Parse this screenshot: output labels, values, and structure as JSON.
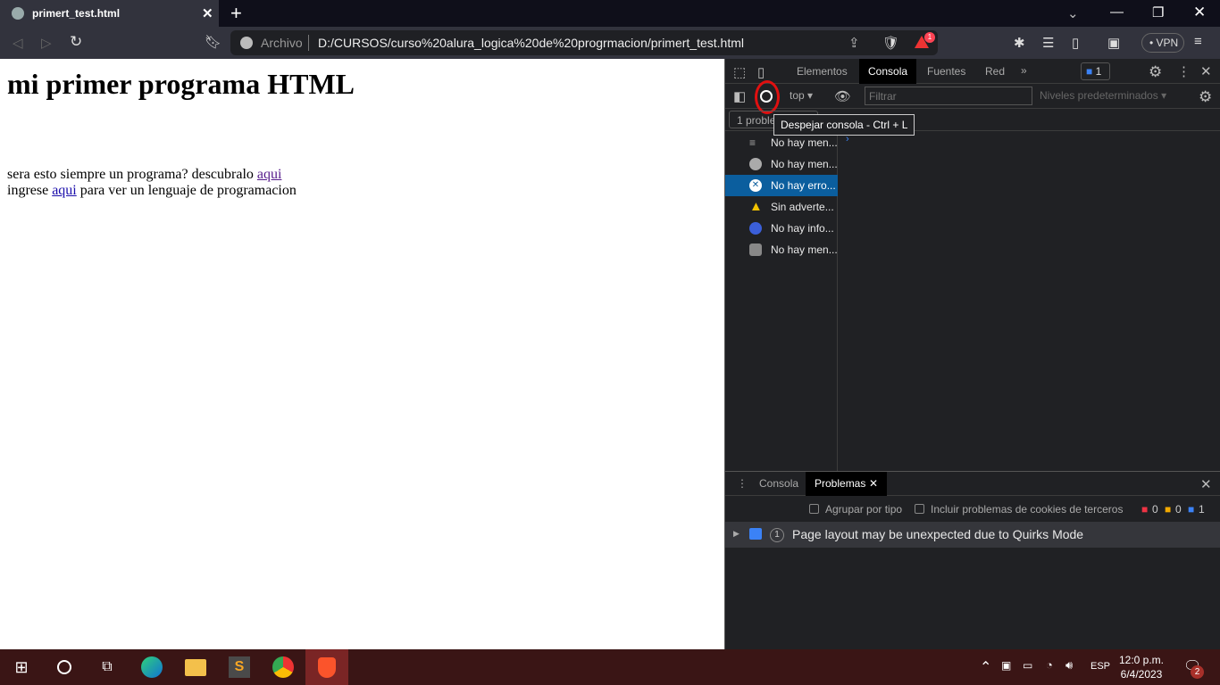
{
  "browser": {
    "tab_title": "primert_test.html",
    "archivo_label": "Archivo",
    "url": "D:/CURSOS/curso%20alura_logica%20de%20progrmacion/primert_test.html",
    "vpn_label": "VPN",
    "rewards_badge": "1"
  },
  "page": {
    "heading": "mi primer programa HTML",
    "line1_text": "sera esto siempre un programa? descubralo ",
    "line1_link": "aqui",
    "line2_prefix": "ingrese ",
    "line2_link": "aqui",
    "line2_suffix": " para ver un lenguaje de programacion"
  },
  "devtools": {
    "tabs": [
      "Elementos",
      "Consola",
      "Fuentes",
      "Red"
    ],
    "active_tab": "Consola",
    "issues_badge": "1",
    "context": "top",
    "filter_placeholder": "Filtrar",
    "levels": "Niveles predeterminados",
    "problems_chip": "1 proble",
    "tooltip": "Despejar consola - Ctrl + L",
    "sidebar": [
      {
        "label": "No hay men...",
        "icon": "list-icon"
      },
      {
        "label": "No hay men...",
        "icon": "user-icon"
      },
      {
        "label": "No hay erro...",
        "icon": "error-icon",
        "selected": true
      },
      {
        "label": "Sin adverte...",
        "icon": "warning-icon"
      },
      {
        "label": "No hay info...",
        "icon": "info-icon"
      },
      {
        "label": "No hay men...",
        "icon": "bug-icon"
      }
    ],
    "drawer": {
      "tabs": [
        "Consola",
        "Problemas"
      ],
      "active": "Problemas",
      "group_by_type": "Agrupar por tipo",
      "include_cookies": "Incluir problemas de cookies de terceros",
      "errors": "0",
      "warnings": "0",
      "infos": "1",
      "issue_count": "1",
      "issue_text": "Page layout may be unexpected due to Quirks Mode"
    }
  },
  "taskbar": {
    "lang": "ESP",
    "time": "12:0 p.m.",
    "date": "6/4/2023",
    "notifications": "2"
  },
  "colors": {
    "highlight_circle": "#e01010",
    "accent": "#0b5e9e"
  }
}
